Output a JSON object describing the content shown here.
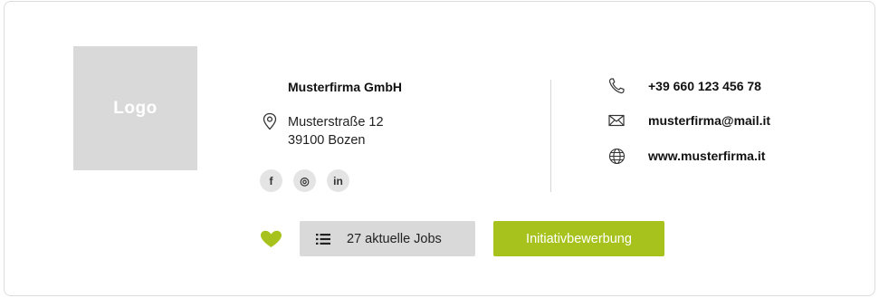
{
  "logo": {
    "label": "Logo"
  },
  "company": {
    "name": "Musterfirma GmbH",
    "street": "Musterstraße 12",
    "city": "39100 Bozen"
  },
  "social": [
    {
      "icon": "facebook-icon",
      "glyph": "f"
    },
    {
      "icon": "instagram-icon",
      "glyph": "◎"
    },
    {
      "icon": "linkedin-icon",
      "glyph": "in"
    }
  ],
  "contact": {
    "phone": "+39 660 123 456 78",
    "email": "musterfirma@mail.it",
    "website": "www.musterfirma.it"
  },
  "actions": {
    "jobs_label": "27 aktuelle Jobs",
    "apply_label": "Initiativbewerbung"
  },
  "colors": {
    "accent": "#a7c21c",
    "placeholder": "#d9d9d9"
  }
}
